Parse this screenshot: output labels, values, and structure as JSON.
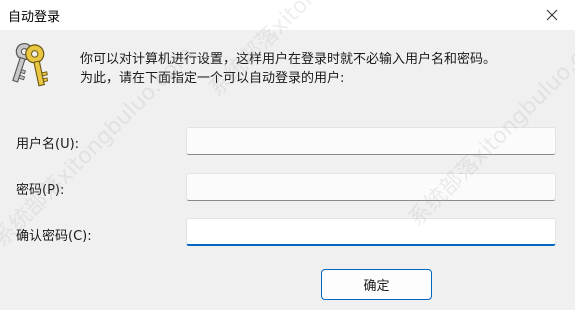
{
  "window": {
    "title": "自动登录"
  },
  "description": {
    "line1": "你可以对计算机进行设置，这样用户在登录时就不必输入用户名和密码。",
    "line2": "为此，请在下面指定一个可以自动登录的用户:"
  },
  "fields": {
    "username": {
      "label": "用户名(U):",
      "value": ""
    },
    "password": {
      "label": "密码(P):",
      "value": ""
    },
    "confirm_password": {
      "label": "确认密码(C):",
      "value": ""
    }
  },
  "buttons": {
    "ok_label": "确定"
  },
  "watermark": {
    "text": "系统部落xitongbuluo.com"
  },
  "icons": {
    "close": "close-icon",
    "keys": "keys-icon"
  },
  "colors": {
    "accent": "#0067c0",
    "background": "#f0f0f0",
    "titlebar": "#ffffff"
  }
}
